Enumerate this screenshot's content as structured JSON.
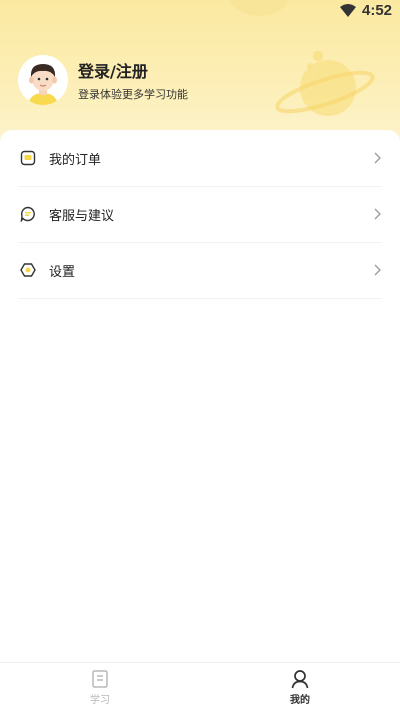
{
  "status_bar": {
    "time": "4:52"
  },
  "profile": {
    "title": "登录/注册",
    "subtitle": "登录体验更多学习功能"
  },
  "menu": [
    {
      "label": "我的订单",
      "icon": "order-icon"
    },
    {
      "label": "客服与建议",
      "icon": "chat-icon"
    },
    {
      "label": "设置",
      "icon": "settings-icon"
    }
  ],
  "tabs": [
    {
      "label": "学习",
      "icon": "book-icon",
      "active": false
    },
    {
      "label": "我的",
      "icon": "user-icon",
      "active": true
    }
  ],
  "colors": {
    "accent": "#f7d64a",
    "header_bg": "#fbe9a1",
    "active_tab": "#333333",
    "inactive_tab": "#b8b8b8"
  }
}
